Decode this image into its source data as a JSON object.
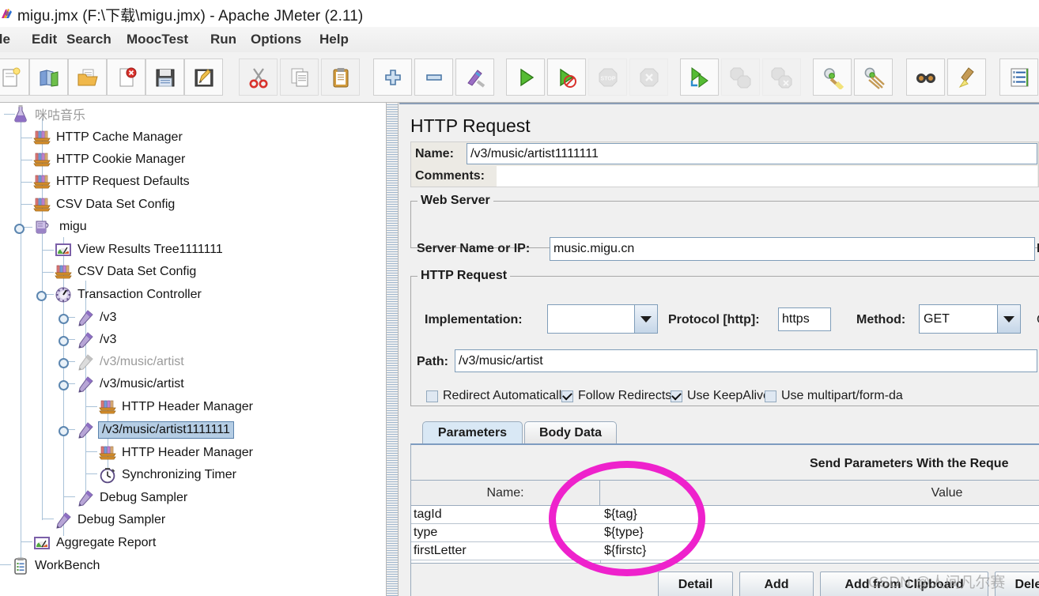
{
  "window": {
    "title": "migu.jmx (F:\\下载\\migu.jmx) - Apache JMeter (2.11)",
    "app_icon": "jmeter-logo-icon"
  },
  "menubar": {
    "items": [
      {
        "label": "ile",
        "mnemonic": ""
      },
      {
        "label": "Edit",
        "mnemonic": "E"
      },
      {
        "label": "Search",
        "mnemonic": ""
      },
      {
        "label": "MoocTest",
        "mnemonic": "M"
      },
      {
        "label": "Run",
        "mnemonic": "R"
      },
      {
        "label": "Options",
        "mnemonic": "O"
      },
      {
        "label": "Help",
        "mnemonic": "H"
      }
    ]
  },
  "toolbar": {
    "buttons": [
      {
        "name": "new-icon",
        "tip": "New",
        "disabled": false
      },
      {
        "name": "templates-icon",
        "tip": "Templates",
        "disabled": false
      },
      {
        "name": "open-icon",
        "tip": "Open",
        "disabled": false
      },
      {
        "name": "close-icon",
        "tip": "Close",
        "disabled": false
      },
      {
        "name": "save-icon",
        "tip": "Save",
        "disabled": false
      },
      {
        "name": "save-as-icon",
        "tip": "Save as",
        "disabled": false
      },
      {
        "name": "cut-icon",
        "tip": "Cut",
        "disabled": false
      },
      {
        "name": "copy-icon",
        "tip": "Copy",
        "disabled": false
      },
      {
        "name": "paste-icon",
        "tip": "Paste",
        "disabled": false
      },
      {
        "name": "expand-all-icon",
        "tip": "Expand all",
        "disabled": false
      },
      {
        "name": "collapse-all-icon",
        "tip": "Collapse all",
        "disabled": false
      },
      {
        "name": "toggle-icon",
        "tip": "Toggle",
        "disabled": false
      },
      {
        "name": "start-icon",
        "tip": "Start",
        "disabled": false
      },
      {
        "name": "start-no-timers-icon",
        "tip": "Start no pauses",
        "disabled": false
      },
      {
        "name": "stop-icon",
        "tip": "Stop",
        "disabled": true
      },
      {
        "name": "shutdown-icon",
        "tip": "Shutdown",
        "disabled": true
      },
      {
        "name": "remote-start-icon",
        "tip": "Remote start all",
        "disabled": false
      },
      {
        "name": "remote-stop-icon",
        "tip": "Remote stop all",
        "disabled": true
      },
      {
        "name": "remote-shutdown-icon",
        "tip": "Remote shutdown",
        "disabled": true
      },
      {
        "name": "clear-icon",
        "tip": "Clear",
        "disabled": false
      },
      {
        "name": "clear-all-icon",
        "tip": "Clear all",
        "disabled": false
      },
      {
        "name": "search-icon",
        "tip": "Search",
        "disabled": false
      },
      {
        "name": "search-reset-icon",
        "tip": "Reset search",
        "disabled": false
      },
      {
        "name": "function-helper-icon",
        "tip": "Function helper",
        "disabled": false
      }
    ]
  },
  "tree": {
    "nodes": [
      {
        "label": "咪咕音乐",
        "icon": "test-plan-icon",
        "depth": 0,
        "state": "dim",
        "toggle": "none"
      },
      {
        "label": "HTTP Cache Manager",
        "icon": "config-element-icon",
        "depth": 1,
        "state": "normal",
        "toggle": "none"
      },
      {
        "label": "HTTP Cookie Manager",
        "icon": "config-element-icon",
        "depth": 1,
        "state": "normal",
        "toggle": "none"
      },
      {
        "label": "HTTP Request Defaults",
        "icon": "config-element-icon",
        "depth": 1,
        "state": "normal",
        "toggle": "none"
      },
      {
        "label": "CSV Data Set Config",
        "icon": "config-element-icon",
        "depth": 1,
        "state": "normal",
        "toggle": "none"
      },
      {
        "label": "migu",
        "icon": "thread-group-icon",
        "depth": 1,
        "state": "normal",
        "toggle": "expanded"
      },
      {
        "label": "View Results Tree1111111",
        "icon": "listener-icon",
        "depth": 2,
        "state": "normal",
        "toggle": "none"
      },
      {
        "label": "CSV Data Set Config",
        "icon": "config-element-icon",
        "depth": 2,
        "state": "normal",
        "toggle": "none"
      },
      {
        "label": "Transaction Controller",
        "icon": "controller-icon",
        "depth": 2,
        "state": "normal",
        "toggle": "expanded"
      },
      {
        "label": "/v3",
        "icon": "http-sampler-icon",
        "depth": 3,
        "state": "normal",
        "toggle": "collapsed"
      },
      {
        "label": "/v3",
        "icon": "http-sampler-icon",
        "depth": 3,
        "state": "normal",
        "toggle": "collapsed"
      },
      {
        "label": "/v3/music/artist",
        "icon": "http-sampler-icon",
        "depth": 3,
        "state": "dim",
        "toggle": "collapsed"
      },
      {
        "label": "/v3/music/artist",
        "icon": "http-sampler-icon",
        "depth": 3,
        "state": "normal",
        "toggle": "expanded"
      },
      {
        "label": "HTTP Header Manager",
        "icon": "config-element-icon",
        "depth": 4,
        "state": "normal",
        "toggle": "none"
      },
      {
        "label": "/v3/music/artist1111111",
        "icon": "http-sampler-icon",
        "depth": 3,
        "state": "selected",
        "toggle": "expanded"
      },
      {
        "label": "HTTP Header Manager",
        "icon": "config-element-icon",
        "depth": 4,
        "state": "normal",
        "toggle": "none"
      },
      {
        "label": "Synchronizing Timer",
        "icon": "timer-icon",
        "depth": 4,
        "state": "normal",
        "toggle": "none"
      },
      {
        "label": "Debug Sampler",
        "icon": "http-sampler-icon",
        "depth": 3,
        "state": "normal",
        "toggle": "none"
      },
      {
        "label": "Debug Sampler",
        "icon": "http-sampler-icon",
        "depth": 2,
        "state": "normal",
        "toggle": "none"
      },
      {
        "label": "Aggregate Report",
        "icon": "listener-icon",
        "depth": 1,
        "state": "normal",
        "toggle": "none"
      },
      {
        "label": "WorkBench",
        "icon": "workbench-icon",
        "depth": 0,
        "state": "normal",
        "toggle": "none"
      }
    ]
  },
  "request": {
    "panel_title": "HTTP Request",
    "name_label": "Name:",
    "name_value": "/v3/music/artist1111111",
    "comments_label": "Comments:",
    "comments_value": "",
    "web_server": {
      "legend": "Web Server",
      "server_label": "Server Name or IP:",
      "server_value": "music.migu.cn",
      "port_label_partial": "P"
    },
    "http_request": {
      "legend": "HTTP Request",
      "implementation_label": "Implementation:",
      "implementation_value": "",
      "protocol_label": "Protocol [http]:",
      "protocol_value": "https",
      "method_label": "Method:",
      "method_value": "GET",
      "path_label": "Path:",
      "path_value": "/v3/music/artist",
      "checkboxes": [
        {
          "label": "Redirect Automatically",
          "checked": false
        },
        {
          "label": "Follow Redirects",
          "checked": true
        },
        {
          "label": "Use KeepAlive",
          "checked": true
        },
        {
          "label": "Use multipart/form-da",
          "checked": false
        }
      ]
    },
    "tabs": [
      {
        "label": "Parameters",
        "active": true
      },
      {
        "label": "Body Data",
        "active": false
      }
    ],
    "send_parameters_label": "Send Parameters With the Reque",
    "table": {
      "headers": [
        "Name:",
        "",
        "Value"
      ],
      "rows": [
        {
          "name": "tagId",
          "value": "${tag}"
        },
        {
          "name": "type",
          "value": "${type}"
        },
        {
          "name": "firstLetter",
          "value": "${firstc}"
        }
      ]
    },
    "buttons": [
      {
        "label": "Detail"
      },
      {
        "label": "Add"
      },
      {
        "label": "Add from Clipboard"
      },
      {
        "label": "Delet"
      }
    ]
  },
  "annotation": {
    "ellipse_color": "#ee22cc",
    "watermark": "CSDN @人间凡尔赛"
  }
}
